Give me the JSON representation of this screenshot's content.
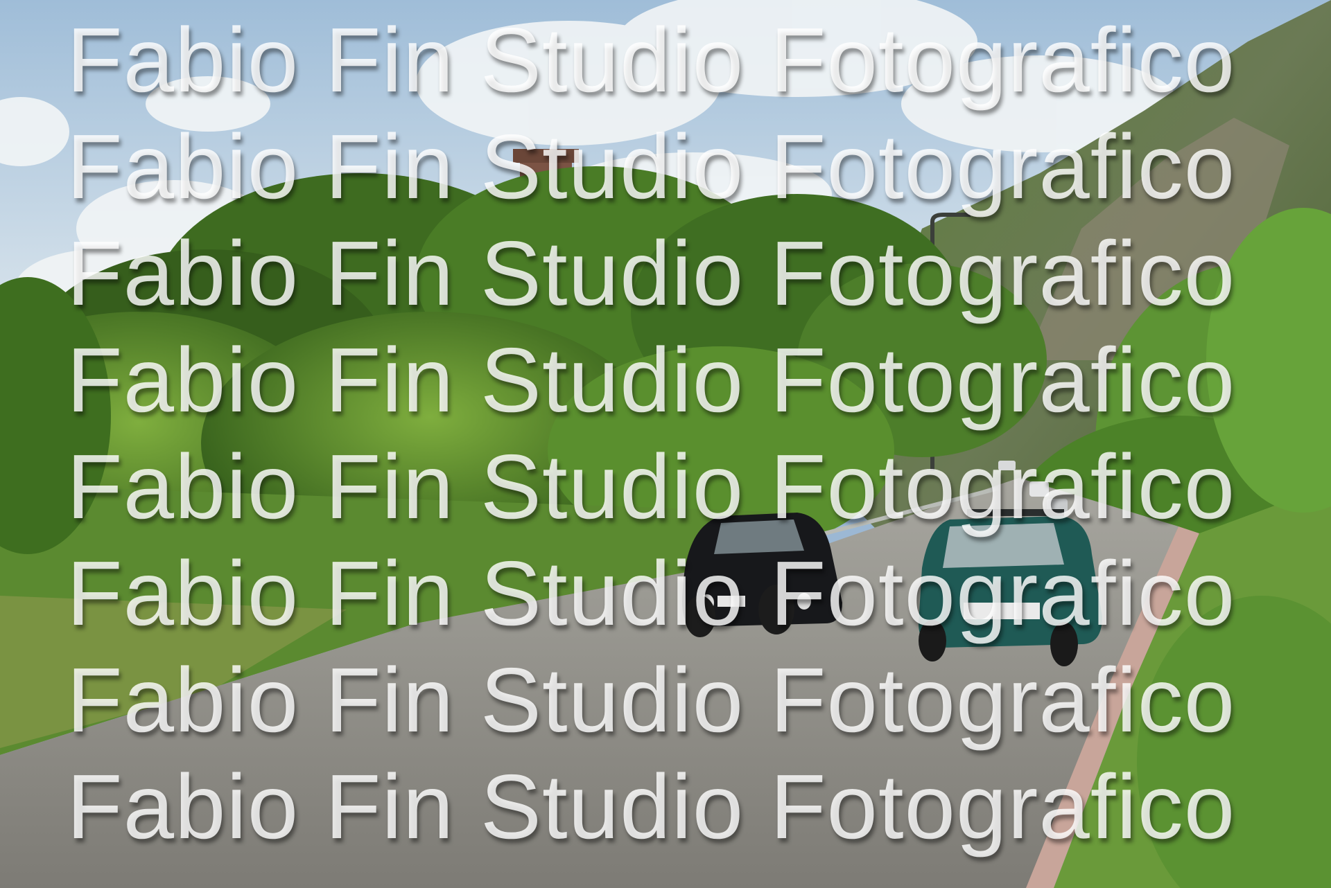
{
  "photo": {
    "subject": "country-road-classic-cars",
    "colors": {
      "sky": "#b9cfe2",
      "cloud": "#f4f6f7",
      "foliage_dark": "#2f5a1a",
      "foliage_mid": "#4f8a2a",
      "foliage_light": "#8dbb4a",
      "road": "#8e8c86",
      "road_edge": "#c9a89c",
      "tower": "#7d5546",
      "car_black": "#17181b",
      "car_teal": "#1f5a55"
    }
  },
  "watermark": {
    "lines": [
      "Fabio Fin Studio Fotografico",
      "Fabio Fin Studio Fotografico",
      "Fabio Fin Studio Fotografico",
      "Fabio Fin Studio Fotografico",
      "Fabio Fin Studio Fotografico",
      "Fabio Fin Studio Fotografico",
      "Fabio Fin Studio Fotografico",
      "Fabio Fin Studio Fotografico"
    ]
  }
}
